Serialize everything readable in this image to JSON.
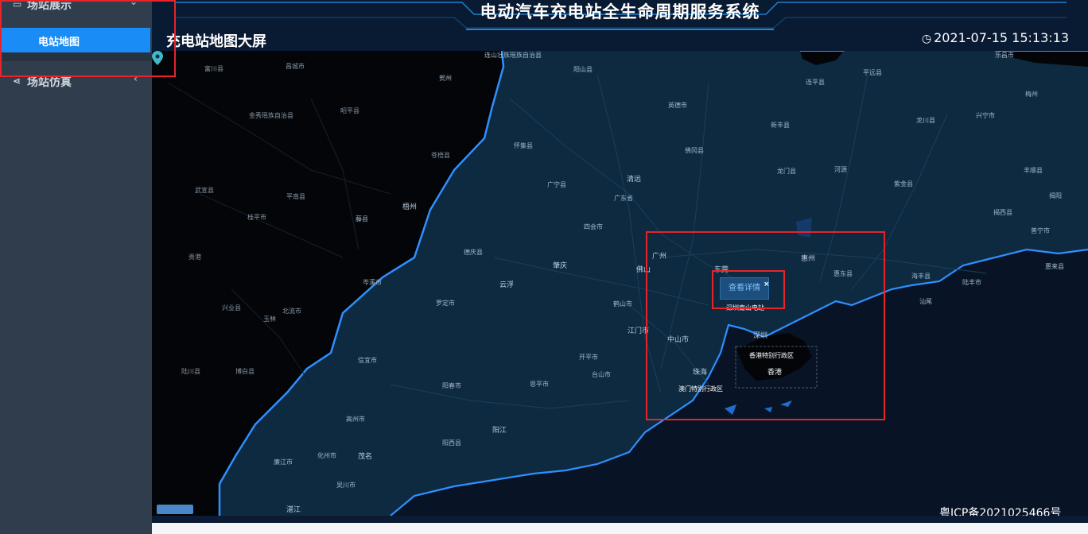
{
  "sidebar": {
    "groups": [
      {
        "label": "场站展示",
        "icon": "monitor-icon"
      },
      {
        "label": "场站仿真",
        "icon": "share-icon"
      }
    ],
    "active_item": {
      "label": "电站地图"
    }
  },
  "header": {
    "system_title": "电动汽车充电站全生命周期服务系统",
    "page_title": "充电站地图大屏",
    "datetime": "2021-07-15 15:13:13"
  },
  "map": {
    "popup": {
      "button_label": "查看详情",
      "close": "×",
      "station": "深圳南山电站"
    },
    "places": [
      {
        "name": "连山壮族瑶族自治县"
      },
      {
        "name": "阳山县"
      },
      {
        "name": "乐昌市"
      },
      {
        "name": "连平县"
      },
      {
        "name": "平远县"
      },
      {
        "name": "梅州"
      },
      {
        "name": "富川县"
      },
      {
        "name": "昌城市"
      },
      {
        "name": "贺州"
      },
      {
        "name": "英德市"
      },
      {
        "name": "新丰县"
      },
      {
        "name": "龙川县"
      },
      {
        "name": "兴宁市"
      },
      {
        "name": "金秀瑶族自治县"
      },
      {
        "name": "昭平县"
      },
      {
        "name": "怀集县"
      },
      {
        "name": "佛冈县"
      },
      {
        "name": "苍梧县"
      },
      {
        "name": "龙门县"
      },
      {
        "name": "河源"
      },
      {
        "name": "丰顺县"
      },
      {
        "name": "广宁县"
      },
      {
        "name": "清远"
      },
      {
        "name": "广东省"
      },
      {
        "name": "紫金县"
      },
      {
        "name": "武宣县"
      },
      {
        "name": "平南县"
      },
      {
        "name": "梧州"
      },
      {
        "name": "揭阳"
      },
      {
        "name": "桂平市"
      },
      {
        "name": "藤县"
      },
      {
        "name": "揭西县"
      },
      {
        "name": "四会市"
      },
      {
        "name": "普宁市"
      },
      {
        "name": "贵港"
      },
      {
        "name": "德庆县"
      },
      {
        "name": "广州"
      },
      {
        "name": "惠州"
      },
      {
        "name": "东莞"
      },
      {
        "name": "肇庆"
      },
      {
        "name": "惠东县"
      },
      {
        "name": "海丰县"
      },
      {
        "name": "陆丰市"
      },
      {
        "name": "惠来县"
      },
      {
        "name": "云浮"
      },
      {
        "name": "佛山"
      },
      {
        "name": "岑溪市"
      },
      {
        "name": "罗定市"
      },
      {
        "name": "鹤山市"
      },
      {
        "name": "汕尾"
      },
      {
        "name": "兴业县"
      },
      {
        "name": "北流市"
      },
      {
        "name": "玉林"
      },
      {
        "name": "江门市"
      },
      {
        "name": "深圳"
      },
      {
        "name": "中山市"
      },
      {
        "name": "香港特别行政区"
      },
      {
        "name": "信宜市"
      },
      {
        "name": "开平市"
      },
      {
        "name": "台山市"
      },
      {
        "name": "香港"
      },
      {
        "name": "珠海"
      },
      {
        "name": "澳门特别行政区"
      },
      {
        "name": "陆川县"
      },
      {
        "name": "博白县"
      },
      {
        "name": "阳春市"
      },
      {
        "name": "恩平市"
      },
      {
        "name": "高州市"
      },
      {
        "name": "阳江"
      },
      {
        "name": "阳西县"
      },
      {
        "name": "廉江市"
      },
      {
        "name": "化州市"
      },
      {
        "name": "茂名"
      },
      {
        "name": "吴川市"
      },
      {
        "name": "湛江"
      }
    ]
  },
  "footer": {
    "icp": "粤ICP备2021025466号"
  },
  "colors": {
    "accent": "#1a8cf5",
    "highlight": "#e8232a",
    "coast": "#2f8fff",
    "sidebar": "#2f3d4c"
  }
}
